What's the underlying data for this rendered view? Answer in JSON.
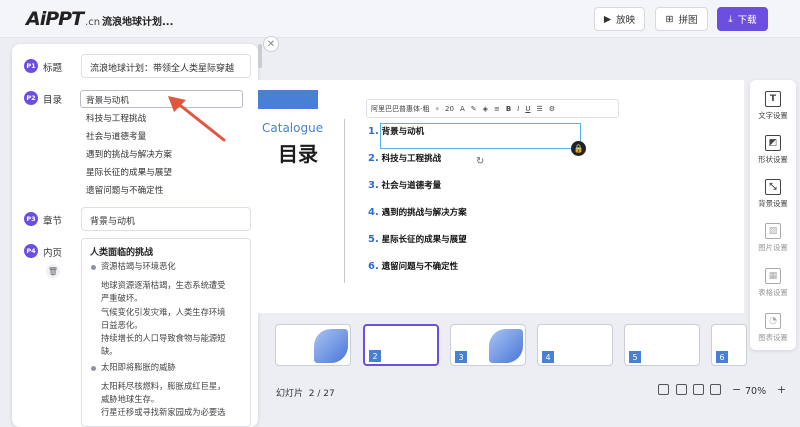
{
  "app": {
    "logo_main": "AiPPT",
    "logo_suffix": ".cn",
    "doc_title": "流浪地球计划..."
  },
  "toolbar": {
    "play_label": "放映",
    "jigsaw_label": "拼图",
    "download_label": "下载"
  },
  "left_panel": {
    "title": {
      "badge": "P1",
      "label": "标题",
      "value": "流浪地球计划：带领全人类星际穿越"
    },
    "toc": {
      "badge": "P2",
      "label": "目录",
      "items": [
        "背景与动机",
        "科技与工程挑战",
        "社会与道德考量",
        "遇到的挑战与解决方案",
        "星际长征的成果与展望",
        "遗留问题与不确定性"
      ]
    },
    "chapter": {
      "badge": "P3",
      "label": "章节",
      "value": "背景与动机"
    },
    "page": {
      "badge": "P4",
      "label": "内页",
      "heading": "人类面临的挑战",
      "bullet1": "资源枯竭与环境恶化",
      "para1": [
        "地球资源逐渐枯竭，生态系统遭受",
        "严重破坏。",
        "气候变化引发灾难，人类生存环境",
        "日益恶化。",
        "持续增长的人口导致食物与能源短",
        "缺。"
      ],
      "bullet2": "太阳即将膨胀的威胁",
      "para2": [
        "太阳耗尽核燃料，膨胀成红巨星，",
        "威胁地球生存。",
        "行星迁移或寻找新家园成为必要选"
      ]
    }
  },
  "slide": {
    "catalogue_en": "Catalogue",
    "catalogue_cn": "目录",
    "items": [
      {
        "num": "1.",
        "text": "背景与动机"
      },
      {
        "num": "2.",
        "text": "科技与工程挑战"
      },
      {
        "num": "3.",
        "text": "社会与道德考量"
      },
      {
        "num": "4.",
        "text": "遇到的挑战与解决方案"
      },
      {
        "num": "5.",
        "text": "星际长征的成果与展望"
      },
      {
        "num": "6.",
        "text": "遗留问题与不确定性"
      }
    ]
  },
  "format_toolbar": {
    "font": "阿里巴巴普惠体-粗",
    "size": "20"
  },
  "right_tools": [
    {
      "icon": "text-icon",
      "label": "文字设置",
      "glyph": "T"
    },
    {
      "icon": "shape-icon",
      "label": "形状设置",
      "glyph": "◩"
    },
    {
      "icon": "background-icon",
      "label": "背景设置",
      "glyph": "⤡"
    },
    {
      "icon": "image-icon",
      "label": "图片设置",
      "glyph": "▨"
    },
    {
      "icon": "table-icon",
      "label": "表格设置",
      "glyph": "▦"
    },
    {
      "icon": "chart-icon",
      "label": "图表设置",
      "glyph": "◔"
    }
  ],
  "thumbnails": [
    "",
    "2",
    "3",
    "4",
    "5",
    "6"
  ],
  "bottom": {
    "slide_label": "幻灯片",
    "slide_count": "2 / 27",
    "zoom": "70%",
    "zoom_minus": "−",
    "zoom_plus": "+"
  },
  "colors": {
    "accent": "#6c4ee0",
    "slide_blue": "#4a7fd6",
    "selection": "#55b3e6"
  }
}
